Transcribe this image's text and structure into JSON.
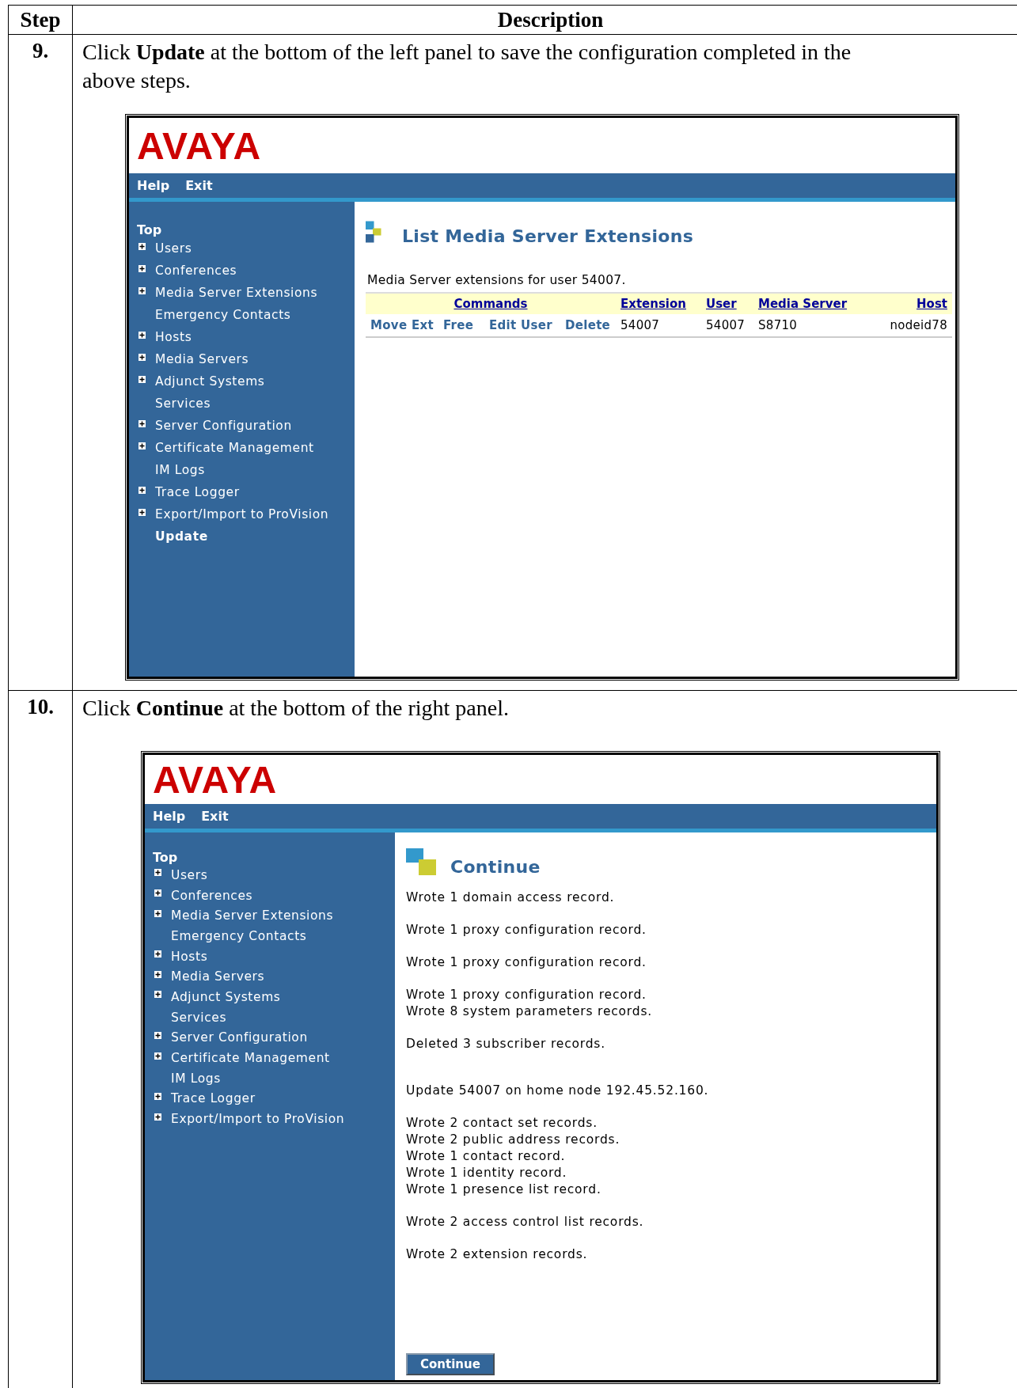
{
  "table": {
    "columns": [
      "Step",
      "Description"
    ],
    "rows": [
      {
        "step": "9.",
        "instruction": "Click **Update** at the bottom of the left panel to save the configuration completed in the above steps.",
        "screen": {
          "logo": "AVAYA",
          "menu": [
            "Help",
            "Exit"
          ],
          "nav_title": "Top",
          "nav": [
            {
              "label": "Users",
              "kind": "expandable"
            },
            {
              "label": "Conferences",
              "kind": "expandable"
            },
            {
              "label": "Media Server Extensions",
              "kind": "expandable"
            },
            {
              "label": "Emergency Contacts",
              "kind": "plain"
            },
            {
              "label": "Hosts",
              "kind": "expandable"
            },
            {
              "label": "Media Servers",
              "kind": "expandable"
            },
            {
              "label": "Adjunct Systems",
              "kind": "expandable"
            },
            {
              "label": "Services",
              "kind": "plain"
            },
            {
              "label": "Server Configuration",
              "kind": "expandable"
            },
            {
              "label": "Certificate Management",
              "kind": "expandable"
            },
            {
              "label": "IM Logs",
              "kind": "plain"
            },
            {
              "label": "Trace Logger",
              "kind": "expandable"
            },
            {
              "label": "Export/Import to ProVision",
              "kind": "expandable"
            },
            {
              "label": "Update",
              "kind": "action"
            }
          ],
          "page_title": "List Media Server Extensions",
          "kind": "list",
          "intro": "Media Server extensions for user 54007.",
          "grid": {
            "columns": [
              "Commands",
              "Extension",
              "User",
              "Media Server",
              "Host"
            ],
            "rows": [
              {
                "commands": [
                  "Move Ext",
                  "Free",
                  "Edit User",
                  "Delete"
                ],
                "extension": "54007",
                "user": "54007",
                "media_server": "S8710",
                "host": "nodeid78"
              }
            ]
          }
        }
      },
      {
        "step": "10.",
        "instruction": "Click **Continue** at the bottom of the right panel.",
        "screen": {
          "logo": "AVAYA",
          "menu": [
            "Help",
            "Exit"
          ],
          "nav_title": "Top",
          "nav": [
            {
              "label": "Users",
              "kind": "expandable"
            },
            {
              "label": "Conferences",
              "kind": "expandable"
            },
            {
              "label": "Media Server Extensions",
              "kind": "expandable"
            },
            {
              "label": "Emergency Contacts",
              "kind": "plain"
            },
            {
              "label": "Hosts",
              "kind": "expandable"
            },
            {
              "label": "Media Servers",
              "kind": "expandable"
            },
            {
              "label": "Adjunct Systems",
              "kind": "expandable"
            },
            {
              "label": "Services",
              "kind": "plain"
            },
            {
              "label": "Server Configuration",
              "kind": "expandable"
            },
            {
              "label": "Certificate Management",
              "kind": "expandable"
            },
            {
              "label": "IM Logs",
              "kind": "plain"
            },
            {
              "label": "Trace Logger",
              "kind": "expandable"
            },
            {
              "label": "Export/Import to ProVision",
              "kind": "expandable"
            }
          ],
          "page_title": "Continue",
          "kind": "messages",
          "messages": [
            [
              "Wrote 1 domain access record."
            ],
            [
              "Wrote 1 proxy configuration record."
            ],
            [
              "Wrote 1 proxy configuration record."
            ],
            [
              "Wrote 1 proxy configuration record.",
              "Wrote 8 system parameters records."
            ],
            [
              "Deleted 3 subscriber records."
            ],
            [
              "Update 54007 on home node 192.45.52.160."
            ],
            [
              "Wrote 2 contact set records.",
              "Wrote 2 public address records.",
              "Wrote 1 contact record.",
              "Wrote 1 identity record.",
              "Wrote 1 presence list record."
            ],
            [
              "Wrote 2 access control list records."
            ],
            [
              "Wrote 2 extension records."
            ]
          ],
          "button": "Continue"
        }
      }
    ]
  }
}
